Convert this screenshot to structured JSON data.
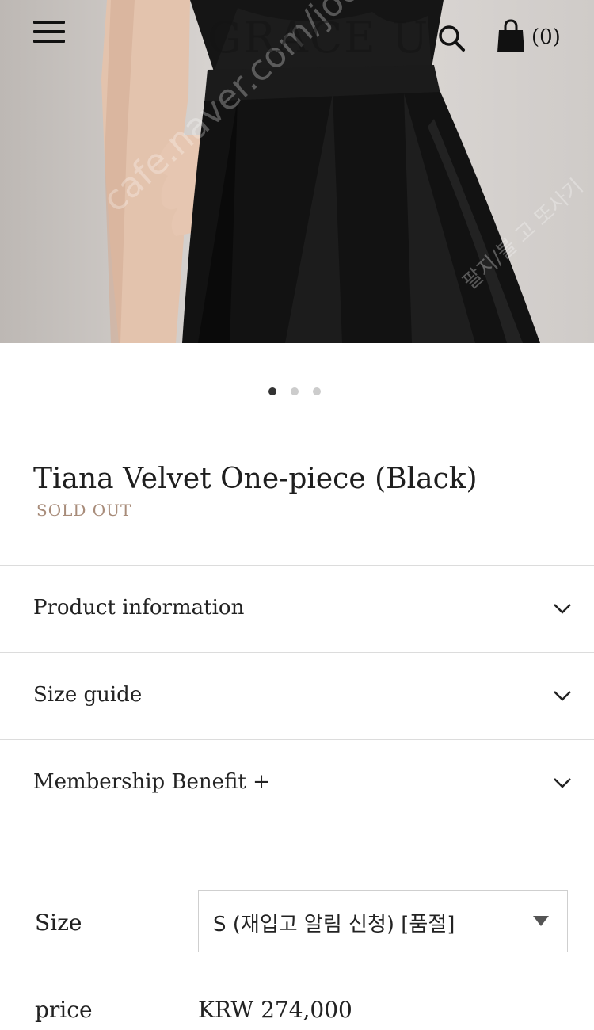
{
  "header": {
    "brand": "GRACE U",
    "cart_count": "(0)",
    "icons": [
      "menu-icon",
      "search-icon",
      "shopping-bag-icon"
    ]
  },
  "hero": {
    "watermark": "cafe.naver.com/joonggonara",
    "watermark_kr": "팔지/볼 고 또사기"
  },
  "carousel": {
    "total": 3,
    "active_index": 0
  },
  "product": {
    "title": "Tiana Velvet One-piece (Black)",
    "status": "SOLD OUT",
    "status_color": "#a88c7a"
  },
  "accordion": [
    {
      "label": "Product information",
      "icon": "chevron-down-icon"
    },
    {
      "label": "Size guide",
      "icon": "chevron-down-icon"
    },
    {
      "label": "Membership Benefit +",
      "icon": "chevron-down-icon"
    }
  ],
  "options": {
    "size_label": "Size",
    "size_selected": "S (재입고 알림 신청) [품절]",
    "price_label": "price",
    "price_value": "KRW 274,000"
  }
}
